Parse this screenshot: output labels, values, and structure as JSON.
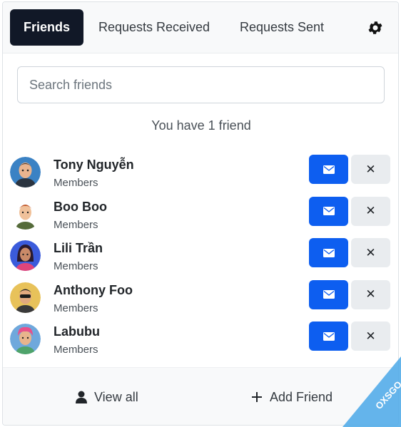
{
  "tabs": [
    {
      "label": "Friends",
      "active": true
    },
    {
      "label": "Requests Received",
      "active": false
    },
    {
      "label": "Requests Sent",
      "active": false
    }
  ],
  "settings": {
    "icon": "gear-icon"
  },
  "search": {
    "placeholder": "Search friends",
    "value": ""
  },
  "count_text": "You have 1 friend",
  "friends": [
    {
      "name": "Tony Nguyễn",
      "role": "Members",
      "avatar_bg": "#3b82c4"
    },
    {
      "name": "Boo Boo",
      "role": "Members",
      "avatar_bg": "#ffffff"
    },
    {
      "name": "Lili Trần",
      "role": "Members",
      "avatar_bg": "#3b5bdb"
    },
    {
      "name": "Anthony Foo",
      "role": "Members",
      "avatar_bg": "#e8c25a"
    },
    {
      "name": "Labubu",
      "role": "Members",
      "avatar_bg": "#6fa8dc"
    }
  ],
  "actions": {
    "message_icon": "envelope-icon",
    "remove_icon": "close-icon",
    "remove_glyph": "✕"
  },
  "footer": {
    "view_all": "View all",
    "add_friend": "Add Friend"
  },
  "colors": {
    "accent": "#0d5ef0",
    "active_tab": "#111827"
  },
  "watermark": {
    "text": "OXSGO"
  }
}
